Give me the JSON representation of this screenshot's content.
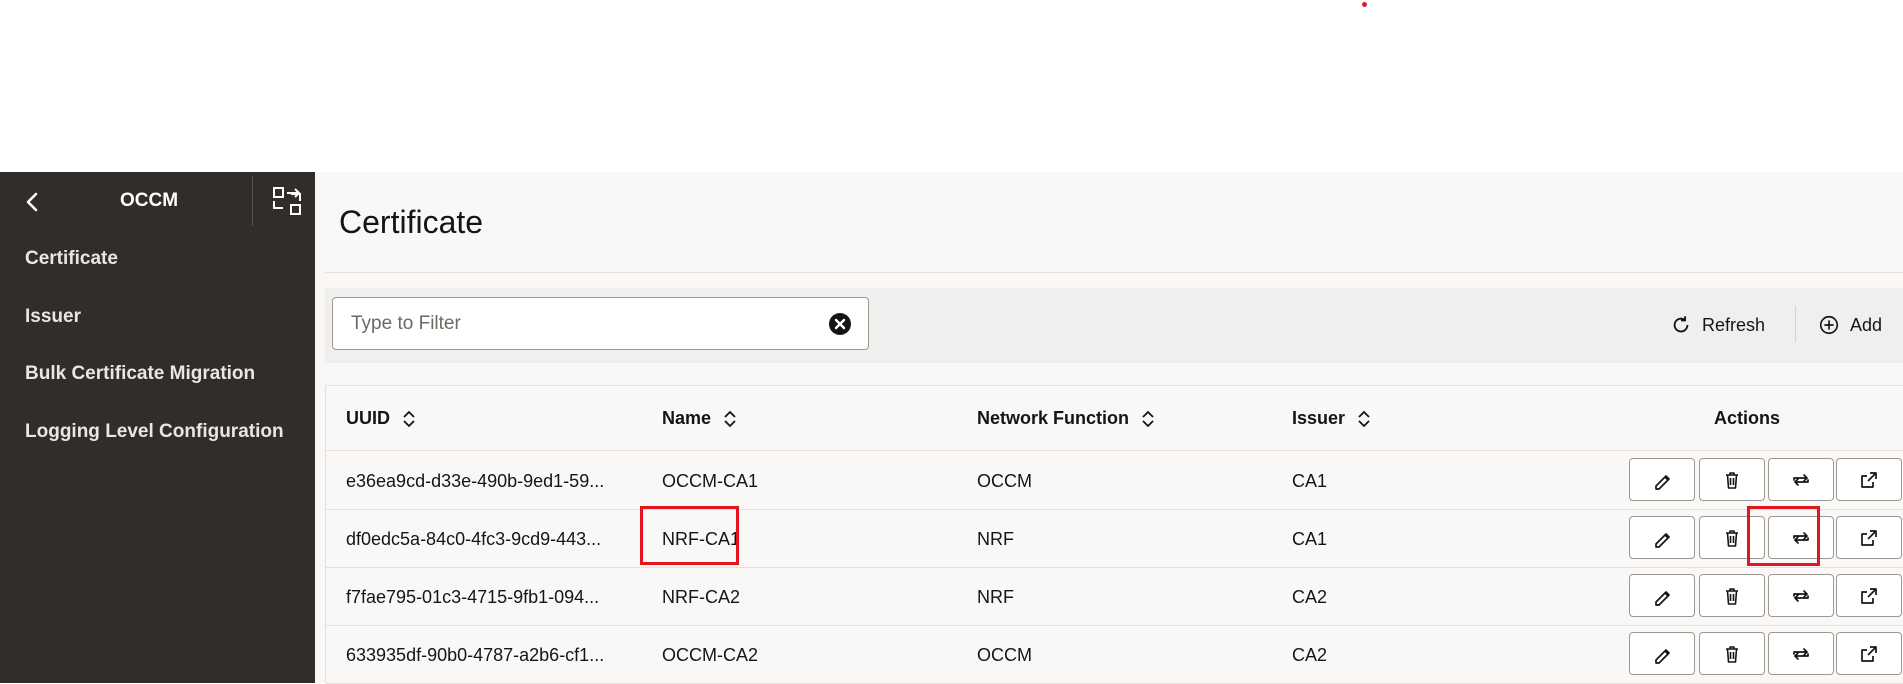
{
  "sidebar": {
    "title": "OCCM",
    "items": [
      {
        "label": "Certificate"
      },
      {
        "label": "Issuer"
      },
      {
        "label": "Bulk Certificate Migration"
      },
      {
        "label": "Logging Level Configuration"
      }
    ]
  },
  "page": {
    "title": "Certificate"
  },
  "toolbar": {
    "filter_placeholder": "Type to Filter",
    "filter_value": "",
    "refresh_label": "Refresh",
    "add_label": "Add"
  },
  "table": {
    "columns": [
      "UUID",
      "Name",
      "Network Function",
      "Issuer",
      "Actions"
    ],
    "rows": [
      {
        "uuid": "e36ea9cd-d33e-490b-9ed1-59...",
        "name": "OCCM-CA1",
        "network_function": "OCCM",
        "issuer": "CA1"
      },
      {
        "uuid": "df0edc5a-84c0-4fc3-9cd9-443...",
        "name": "NRF-CA1",
        "network_function": "NRF",
        "issuer": "CA1"
      },
      {
        "uuid": "f7fae795-01c3-4715-9fb1-094...",
        "name": "NRF-CA2",
        "network_function": "NRF",
        "issuer": "CA2"
      },
      {
        "uuid": "633935df-90b0-4787-a2b6-cf1...",
        "name": "OCCM-CA2",
        "network_function": "OCCM",
        "issuer": "CA2"
      }
    ],
    "row_actions": [
      "pencil-icon",
      "trash-icon",
      "renew-icon",
      "open-external-icon"
    ]
  },
  "colors": {
    "sidebar_bg": "#312d2a",
    "highlight": "#e4151f",
    "page_bg": "#f9f8f7"
  }
}
